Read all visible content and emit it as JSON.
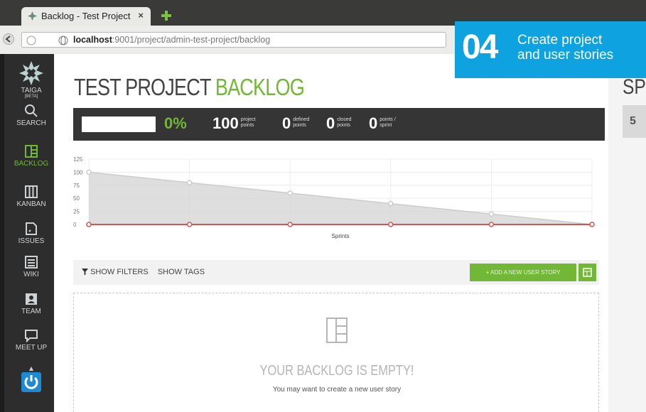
{
  "browser": {
    "tab_title": "Backlog - Test Project",
    "tab_close": "×",
    "url_host": "localhost",
    "url_rest": ":9001/project/admin-test-project/backlog"
  },
  "badge": {
    "number": "04",
    "line1": "Create project",
    "line2": "and user stories"
  },
  "sidebar": {
    "logo_line1": "TAIGA",
    "logo_line2": "[BETA]",
    "items": [
      {
        "label": "SEARCH",
        "icon": "search-icon"
      },
      {
        "label": "BACKLOG",
        "icon": "backlog-icon",
        "active": true
      },
      {
        "label": "KANBAN",
        "icon": "kanban-icon"
      },
      {
        "label": "ISSUES",
        "icon": "issues-icon"
      },
      {
        "label": "WIKI",
        "icon": "wiki-icon"
      },
      {
        "label": "TEAM",
        "icon": "team-icon"
      },
      {
        "label": "MEET UP",
        "icon": "meetup-icon"
      },
      {
        "label": "",
        "icon": "power-icon"
      }
    ]
  },
  "page": {
    "title_main": "TEST PROJECT",
    "title_accent": "BACKLOG"
  },
  "stats": {
    "progress_percent": "0%",
    "project_points": "100",
    "project_points_label1": "project",
    "project_points_label2": "points",
    "defined_points": "0",
    "defined_label1": "defined",
    "defined_label2": "points",
    "closed_points": "0",
    "closed_label1": "closed",
    "closed_label2": "points",
    "points_sprint": "0",
    "points_sprint_label1": "points /",
    "points_sprint_label2": "sprint"
  },
  "chart_data": {
    "type": "line",
    "xlabel": "Sprints",
    "ylabel": "",
    "ylim": [
      0,
      125
    ],
    "y_ticks": [
      "125",
      "100",
      "75",
      "50",
      "25",
      "0"
    ],
    "x": [
      0,
      1,
      2,
      3,
      4,
      5
    ],
    "series": [
      {
        "values": [
          100,
          80,
          60,
          40,
          20,
          0
        ],
        "color": "#cccccc"
      },
      {
        "values": [
          0,
          0,
          0,
          0,
          0,
          0
        ],
        "color": "#d9534f"
      }
    ],
    "grid": true
  },
  "toolbar": {
    "show_filters": "SHOW FILTERS",
    "show_tags": "SHOW TAGS",
    "add_story": "+ ADD A NEW USER STORY"
  },
  "empty": {
    "title": "YOUR BACKLOG IS EMPTY!",
    "subtitle": "You may want to create a new user story"
  },
  "right_panel": {
    "title": "SPI",
    "value": "5"
  },
  "colors": {
    "accent": "#72b736",
    "badge": "#0ea3e0",
    "sidebar": "#2d2d2d",
    "statsbar": "#353535"
  }
}
